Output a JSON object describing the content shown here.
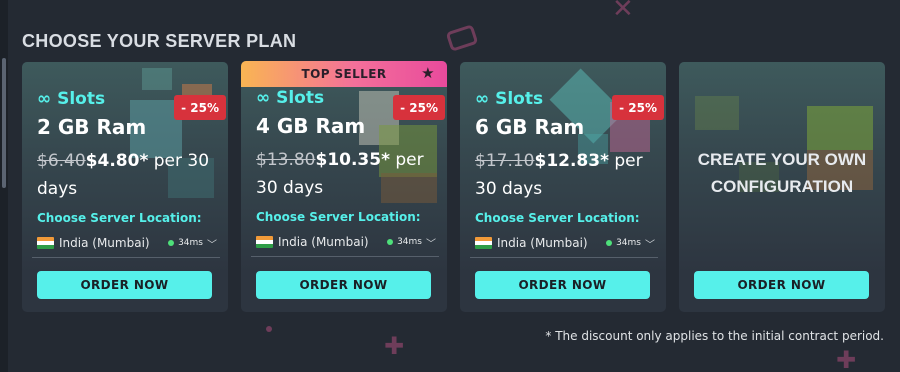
{
  "section_title": "CHOOSE YOUR SERVER PLAN",
  "colors": {
    "accent": "#56f0ea",
    "discount": "#d7323c",
    "ping": "#4ee07a",
    "background": "#242a33"
  },
  "plans": [
    {
      "badge": "",
      "discount": "- 25%",
      "slots": "∞ Slots",
      "ram": "2 GB Ram",
      "old_price": "$6.40",
      "new_price": "$4.80*",
      "period": " per 30 days",
      "location_label": "Choose Server Location:",
      "location": "India (Mumbai)",
      "ping": "34ms",
      "order_label": "ORDER NOW"
    },
    {
      "badge": "TOP SELLER",
      "discount": "- 25%",
      "slots": "∞ Slots",
      "ram": "4 GB Ram",
      "old_price": "$13.80",
      "new_price": "$10.35*",
      "period": " per 30 days",
      "location_label": "Choose Server Location:",
      "location": "India (Mumbai)",
      "ping": "34ms",
      "order_label": "ORDER NOW"
    },
    {
      "badge": "",
      "discount": "- 25%",
      "slots": "∞ Slots",
      "ram": "6 GB Ram",
      "old_price": "$17.10",
      "new_price": "$12.83*",
      "period": " per 30 days",
      "location_label": "Choose Server Location:",
      "location": "India (Mumbai)",
      "ping": "34ms",
      "order_label": "ORDER NOW"
    }
  ],
  "custom": {
    "title": "CREATE YOUR OWN CONFIGURATION",
    "order_label": "ORDER NOW"
  },
  "footnote": "* The discount only applies to the initial contract period."
}
